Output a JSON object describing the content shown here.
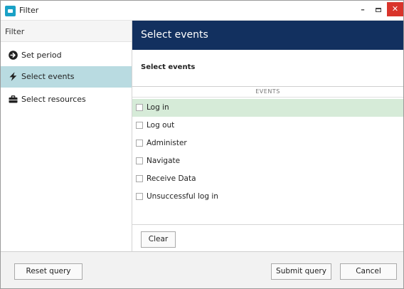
{
  "window": {
    "title": "Filter",
    "minimize_glyph": "–",
    "close_glyph": "✕"
  },
  "left_panel": {
    "header": "Filter",
    "items": [
      {
        "label": "Set period",
        "icon": "arrow-circle-right-icon"
      },
      {
        "label": "Select events",
        "icon": "lightning-bolt-icon"
      },
      {
        "label": "Select resources",
        "icon": "briefcase-icon"
      }
    ],
    "selected_index": 1
  },
  "content": {
    "header": "Select events",
    "section_title": "Select events",
    "column_header": "EVENTS",
    "events": [
      {
        "label": "Log in",
        "checked": false,
        "highlighted": true
      },
      {
        "label": "Log out",
        "checked": false
      },
      {
        "label": "Administer",
        "checked": false
      },
      {
        "label": "Navigate",
        "checked": false
      },
      {
        "label": "Receive Data",
        "checked": false
      },
      {
        "label": "Unsuccessful log in",
        "checked": false
      }
    ],
    "clear_label": "Clear"
  },
  "footer": {
    "reset_label": "Reset query",
    "submit_label": "Submit query",
    "cancel_label": "Cancel"
  },
  "colors": {
    "header_bg": "#12305f",
    "selected_nav_bg": "#b9dbe1",
    "highlight_row_bg": "#d6ebd8",
    "close_button_bg": "#d9342b",
    "app_icon": "#1aa1c6"
  }
}
